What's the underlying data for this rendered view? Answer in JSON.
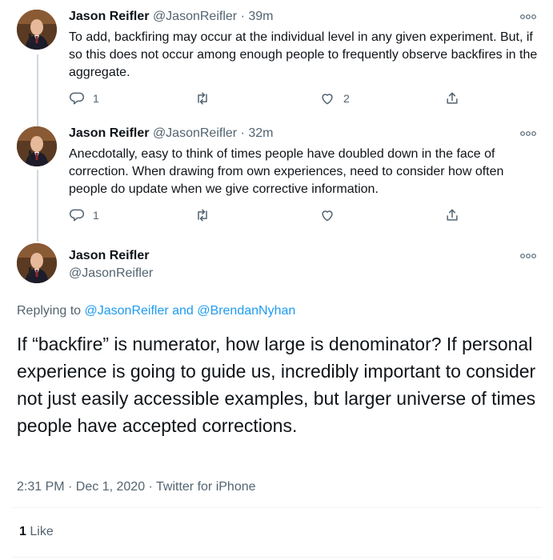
{
  "thread": {
    "tweets": [
      {
        "author": "Jason Reifler",
        "handle": "@JasonReifler",
        "time": "· 39m",
        "text": "To add, backfiring may occur at the individual level in any given experiment. But, if so this does not occur among enough people to frequently observe backfires in the aggregate.",
        "replies": "1",
        "retweets": "",
        "likes": "2"
      },
      {
        "author": "Jason Reifler",
        "handle": "@JasonReifler",
        "time": "· 32m",
        "text": "Anecdotally, easy to think of times people have doubled down in the face of correction. When drawing from own experiences, need to consider how often people do update when we give corrective information.",
        "replies": "1",
        "retweets": "",
        "likes": ""
      }
    ]
  },
  "main_tweet": {
    "author": "Jason Reifler",
    "handle": "@JasonReifler",
    "replying_prefix": "Replying to",
    "replying_user1": "@JasonReifler",
    "replying_and": "and",
    "replying_user2": "@BrendanNyhan",
    "text": "If “backfire” is numerator, how large is denominator? If personal experience is going to guide us, incredibly important to consider not just easily accessible examples, but larger universe of times people have accepted corrections.",
    "timestamp": "2:31 PM · Dec 1, 2020 · Twitter for iPhone",
    "like_count": "1",
    "like_label": "Like"
  },
  "icons": {
    "reply": "reply-icon",
    "retweet": "retweet-icon",
    "like": "heart-icon",
    "share": "share-icon",
    "more": "more-options-icon"
  },
  "colors": {
    "link": "#1d9bf0",
    "secondary": "#536471",
    "thread_line": "#cfd9de"
  }
}
